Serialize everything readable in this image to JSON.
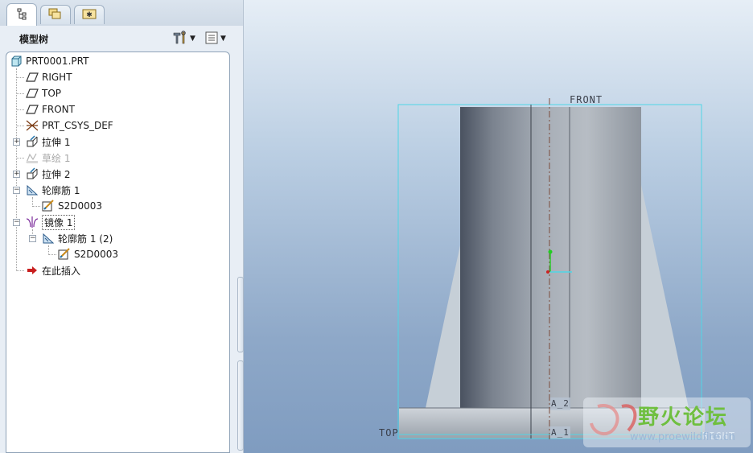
{
  "panel": {
    "tabs": [
      {
        "name": "model-tree-tab",
        "icon": "tree-icon"
      },
      {
        "name": "folder-browser-tab",
        "icon": "folders-icon"
      },
      {
        "name": "favorites-tab",
        "icon": "star-folder-icon"
      }
    ],
    "title": "模型树",
    "settings_icon": "tools-icon",
    "show_icon": "list-icon"
  },
  "tree": {
    "items": [
      {
        "label": "PRT0001.PRT",
        "icon": "part-icon",
        "dim": false
      },
      {
        "label": "RIGHT",
        "icon": "datum-plane-icon",
        "dim": false
      },
      {
        "label": "TOP",
        "icon": "datum-plane-icon",
        "dim": false
      },
      {
        "label": "FRONT",
        "icon": "datum-plane-icon",
        "dim": false
      },
      {
        "label": "PRT_CSYS_DEF",
        "icon": "csys-icon",
        "dim": false
      },
      {
        "label": "拉伸 1",
        "icon": "extrude-icon",
        "dim": false
      },
      {
        "label": "草绘 1",
        "icon": "sketch-icon",
        "dim": true
      },
      {
        "label": "拉伸 2",
        "icon": "extrude-icon",
        "dim": false
      },
      {
        "label": "轮廓筋 1",
        "icon": "rib-icon",
        "dim": false
      },
      {
        "label": "S2D0003",
        "icon": "section-icon",
        "dim": false
      },
      {
        "label": "镜像 1",
        "icon": "mirror-icon",
        "dim": false
      },
      {
        "label": "轮廓筋 1 (2)",
        "icon": "rib-icon",
        "dim": false
      },
      {
        "label": "S2D0003",
        "icon": "section-icon",
        "dim": false
      },
      {
        "label": "在此插入",
        "icon": "insert-arrow-icon",
        "dim": false
      }
    ]
  },
  "graphics": {
    "labels": {
      "front": "FRONT",
      "top": "TOP",
      "right": "RIGHT",
      "axis_a2": "A_2",
      "axis_a1": "A_1"
    },
    "watermark": {
      "text": "野火论坛",
      "url": "www.proewildfire.cn"
    }
  },
  "colors": {
    "datum_cyan": "#4fd6e6",
    "csys_green": "#22cc22",
    "csys_red": "#cc2222",
    "insert_arrow": "#c81e1e",
    "watermark_green": "#6fbf3f"
  }
}
